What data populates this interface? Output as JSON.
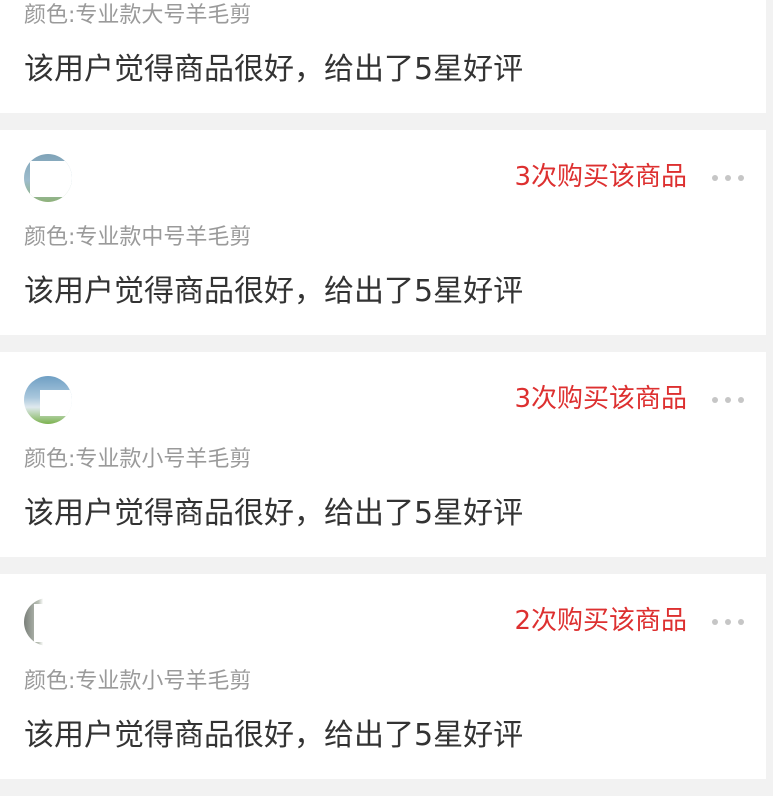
{
  "reviews": [
    {
      "spec": "颜色:专业款大号羊毛剪",
      "text": "该用户觉得商品很好，给出了5星好评"
    },
    {
      "avatar_icon": "user-avatar-icon",
      "purchase_count": "3次购买该商品",
      "more_icon": "more-dots-icon",
      "spec": "颜色:专业款中号羊毛剪",
      "text": "该用户觉得商品很好，给出了5星好评"
    },
    {
      "avatar_icon": "user-avatar-icon",
      "purchase_count": "3次购买该商品",
      "more_icon": "more-dots-icon",
      "spec": "颜色:专业款小号羊毛剪",
      "text": "该用户觉得商品很好，给出了5星好评"
    },
    {
      "avatar_icon": "user-avatar-icon",
      "purchase_count": "2次购买该商品",
      "more_icon": "more-dots-icon",
      "spec": "颜色:专业款小号羊毛剪",
      "text": "该用户觉得商品很好，给出了5星好评"
    }
  ],
  "colors": {
    "page_background": "#f2f2f2",
    "card_background": "#ffffff",
    "purchase_count": "#dd3030",
    "spec_text": "#9a9a9a",
    "review_text": "#333333",
    "more_dots": "#c6c6c6"
  }
}
